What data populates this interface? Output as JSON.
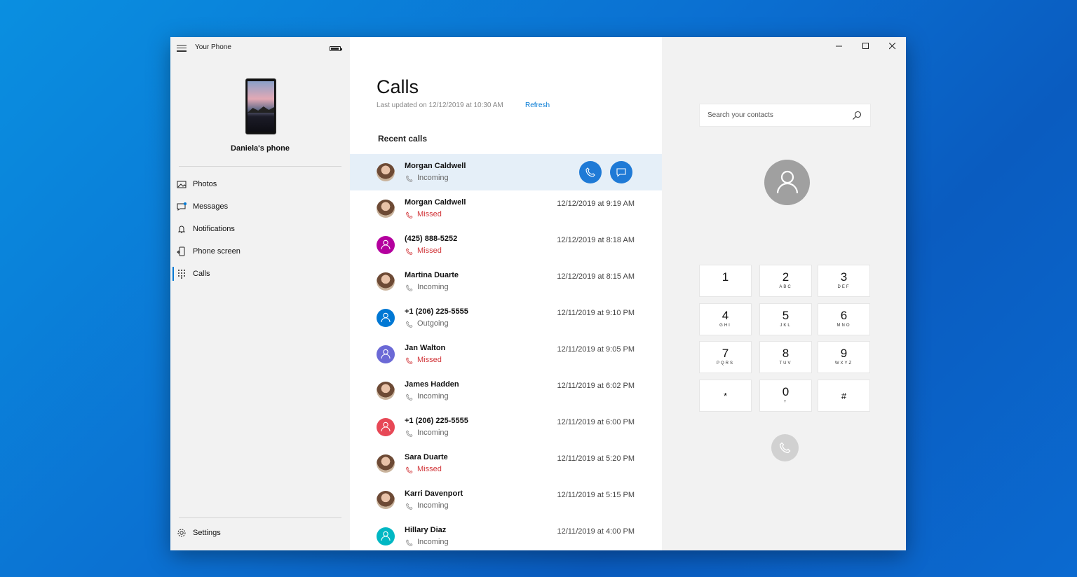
{
  "app": {
    "title": "Your Phone",
    "phone_name": "Daniela's phone"
  },
  "sidebar": {
    "items": [
      {
        "label": "Photos",
        "icon": "photos-icon"
      },
      {
        "label": "Messages",
        "icon": "messages-icon"
      },
      {
        "label": "Notifications",
        "icon": "bell-icon"
      },
      {
        "label": "Phone screen",
        "icon": "phone-screen-icon"
      },
      {
        "label": "Calls",
        "icon": "dialpad-icon",
        "active": true
      }
    ],
    "settings_label": "Settings"
  },
  "calls": {
    "title": "Calls",
    "last_updated": "Last updated on 12/12/2019 at 10:30 AM",
    "refresh_label": "Refresh",
    "recent_heading": "Recent calls",
    "rows": [
      {
        "name": "Morgan Caldwell",
        "type": "Incoming",
        "time": "",
        "missed": false,
        "avatar": "photo",
        "color": ""
      },
      {
        "name": "Morgan Caldwell",
        "type": "Missed",
        "time": "12/12/2019 at 9:19 AM",
        "missed": true,
        "avatar": "photo",
        "color": ""
      },
      {
        "name": "(425) 888-5252",
        "type": "Missed",
        "time": "12/12/2019 at 8:18 AM",
        "missed": true,
        "avatar": "initial",
        "color": "#b4009e"
      },
      {
        "name": "Martina Duarte",
        "type": "Incoming",
        "time": "12/12/2019 at 8:15 AM",
        "missed": false,
        "avatar": "photo",
        "color": ""
      },
      {
        "name": "+1 (206) 225-5555",
        "type": "Outgoing",
        "time": "12/11/2019 at 9:10 PM",
        "missed": false,
        "avatar": "initial",
        "color": "#0078d4"
      },
      {
        "name": "Jan Walton",
        "type": "Missed",
        "time": "12/11/2019 at 9:05 PM",
        "missed": true,
        "avatar": "initial",
        "color": "#6b69d6"
      },
      {
        "name": "James Hadden",
        "type": "Incoming",
        "time": "12/11/2019 at 6:02 PM",
        "missed": false,
        "avatar": "photo",
        "color": ""
      },
      {
        "name": "+1 (206) 225-5555",
        "type": "Incoming",
        "time": "12/11/2019 at 6:00 PM",
        "missed": false,
        "avatar": "initial",
        "color": "#e74856"
      },
      {
        "name": "Sara Duarte",
        "type": "Missed",
        "time": "12/11/2019 at 5:20 PM",
        "missed": true,
        "avatar": "photo",
        "color": ""
      },
      {
        "name": "Karri Davenport",
        "type": "Incoming",
        "time": "12/11/2019 at 5:15 PM",
        "missed": false,
        "avatar": "photo",
        "color": ""
      },
      {
        "name": "Hillary Diaz",
        "type": "Incoming",
        "time": "12/11/2019 at 4:00 PM",
        "missed": false,
        "avatar": "initial",
        "color": "#00b7c3"
      }
    ]
  },
  "dialer": {
    "search_placeholder": "Search your contacts",
    "keys": [
      {
        "digit": "1",
        "letters": ""
      },
      {
        "digit": "2",
        "letters": "ABC"
      },
      {
        "digit": "3",
        "letters": "DEF"
      },
      {
        "digit": "4",
        "letters": "GHI"
      },
      {
        "digit": "5",
        "letters": "JKL"
      },
      {
        "digit": "6",
        "letters": "MNO"
      },
      {
        "digit": "7",
        "letters": "PQRS"
      },
      {
        "digit": "8",
        "letters": "TUV"
      },
      {
        "digit": "9",
        "letters": "WXYZ"
      },
      {
        "digit": "*",
        "letters": ""
      },
      {
        "digit": "0",
        "letters": "+"
      },
      {
        "digit": "#",
        "letters": ""
      }
    ]
  },
  "colors": {
    "accent": "#0078d4",
    "missed": "#d13438",
    "selected_row": "#e5eff8"
  }
}
